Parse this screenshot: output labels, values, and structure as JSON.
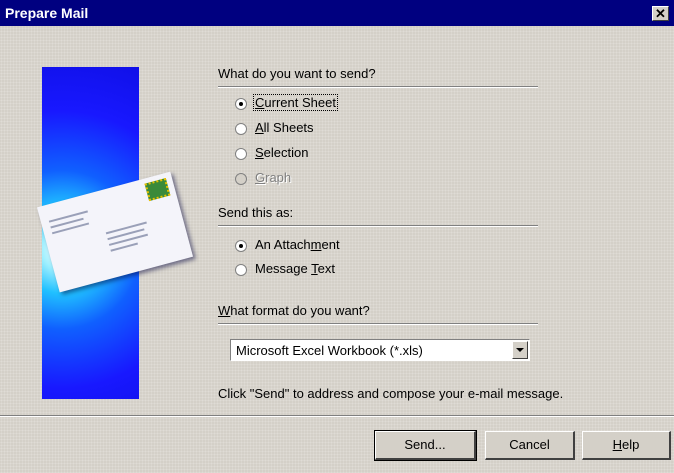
{
  "window": {
    "title": "Prepare Mail",
    "close_glyph": "✕"
  },
  "icons": {
    "close": "close-icon",
    "envelope": "envelope-icon",
    "dropdown_arrow": "chevron-down-icon"
  },
  "send_what": {
    "heading": "What do you want to send?",
    "options": [
      {
        "label": "Current Sheet",
        "accel": "C",
        "selected": true,
        "enabled": true
      },
      {
        "label": "All Sheets",
        "accel": "A",
        "selected": false,
        "enabled": true
      },
      {
        "label": "Selection",
        "accel": "S",
        "selected": false,
        "enabled": true
      },
      {
        "label": "Graph",
        "accel": "G",
        "selected": false,
        "enabled": false
      }
    ]
  },
  "send_as": {
    "heading": "Send this as:",
    "options": [
      {
        "label": "An Attachment",
        "accel": "m",
        "selected": true,
        "enabled": true
      },
      {
        "label": "Message Text",
        "accel": "T",
        "selected": false,
        "enabled": true
      }
    ]
  },
  "format": {
    "heading": "What format do you want?",
    "heading_accel": "W",
    "selected_value": "Microsoft Excel Workbook (*.xls)"
  },
  "hint": "Click \"Send\" to address and compose your e-mail message.",
  "buttons": {
    "send": "Send...",
    "cancel": "Cancel",
    "help": "Help",
    "help_accel": "H"
  },
  "colors": {
    "titlebar": "#000080",
    "dialog_face": "#d4d0c8",
    "panel_blue": "#1818ff"
  }
}
